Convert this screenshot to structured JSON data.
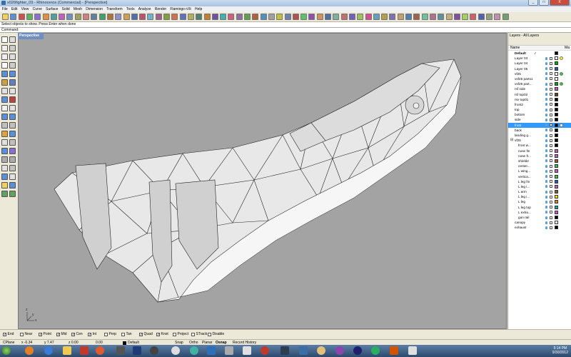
{
  "window": {
    "title": "x026fighter_09 - Rhinoceros (Commercial) - [Perspective]",
    "minimize": "_",
    "maximize": "□",
    "close": "X"
  },
  "menu": [
    "File",
    "Edit",
    "View",
    "Curve",
    "Surface",
    "Solid",
    "Mesh",
    "Dimension",
    "Transform",
    "Tools",
    "Analyze",
    "Render",
    "Flamingo nXt",
    "Help"
  ],
  "prompt": "Select objects to show. Press Enter when done",
  "command": {
    "label": "Command:"
  },
  "viewport": {
    "label": "Perspective",
    "axis_x": "x",
    "axis_y": "y",
    "axis_z": "z"
  },
  "layers_panel": {
    "title": "Layers - All Layers",
    "col_name": "Name",
    "col_mat": "Ma",
    "layers": [
      {
        "name": "Default",
        "bold": true,
        "check": "✓",
        "color": "#000000",
        "mat": false,
        "sel": false
      },
      {
        "name": "Layer 03",
        "color": "#ffffff",
        "mat": true,
        "mat_color": "#ffff00",
        "sel": false
      },
      {
        "name": "Layer 04",
        "color": "#00aa00",
        "mat": false,
        "sel": false
      },
      {
        "name": "Layer 05",
        "color": "#1f5fbf",
        "mat": false,
        "sel": false
      },
      {
        "name": "vf25",
        "color": "#ffffff",
        "mat": true,
        "mat_color": "#2ecc40",
        "sel": false
      },
      {
        "name": "vsf25 parts1",
        "color": "#ffffff",
        "mat": false,
        "sel": false
      },
      {
        "name": "vsf25 part...",
        "color": "#00aa00",
        "mat": true,
        "mat_color": "#2ecc40",
        "sel": false
      },
      {
        "name": "rsf side",
        "color": "#c65bcf",
        "mat": false,
        "sel": false
      },
      {
        "name": "rsf top02",
        "color": "#7f3f00",
        "mat": false,
        "sel": false
      },
      {
        "name": "rsv top01",
        "color": "#000000",
        "mat": false,
        "sel": false
      },
      {
        "name": "front2",
        "color": "#000000",
        "mat": false,
        "sel": false
      },
      {
        "name": "top",
        "color": "#000000",
        "mat": false,
        "sel": false
      },
      {
        "name": "bottom",
        "color": "#000000",
        "mat": false,
        "sel": false
      },
      {
        "name": "side",
        "color": "#000000",
        "mat": false,
        "sel": false
      },
      {
        "name": "front",
        "color": "#000000",
        "mat": true,
        "mat_color": "#ffffff",
        "sel": true
      },
      {
        "name": "back",
        "color": "#000000",
        "mat": false,
        "sel": false
      },
      {
        "name": "landing g...",
        "color": "#000000",
        "mat": false,
        "sel": false
      },
      {
        "name": "vf25",
        "color": "#000000",
        "mat": false,
        "sel": false,
        "group": true
      },
      {
        "name": "front w...",
        "color": "#000000",
        "mat": false,
        "sel": false,
        "indent": true
      },
      {
        "name": "nose fin",
        "color": "#c65bcf",
        "mat": false,
        "sel": false,
        "indent": true
      },
      {
        "name": "nose fr...",
        "color": "#c65bcf",
        "mat": false,
        "sel": false,
        "indent": true
      },
      {
        "name": "shield2",
        "color": "#a05a2c",
        "mat": false,
        "sel": false,
        "indent": true
      },
      {
        "name": "center...",
        "color": "#2ecc40",
        "mat": false,
        "sel": false,
        "indent": true
      },
      {
        "name": "L wing...",
        "color": "#c65bcf",
        "mat": false,
        "sel": false,
        "indent": true
      },
      {
        "name": "vertica...",
        "color": "#2ecc40",
        "mat": false,
        "sel": false,
        "indent": true
      },
      {
        "name": "L leg fin",
        "color": "#1f5fbf",
        "mat": false,
        "sel": false,
        "indent": true
      },
      {
        "name": "L leg i...",
        "color": "#c65bcf",
        "mat": false,
        "sel": false,
        "indent": true
      },
      {
        "name": "L arm",
        "color": "#8b5a2b",
        "mat": false,
        "sel": false,
        "indent": true
      },
      {
        "name": "L leg i...",
        "color": "#e6e600",
        "mat": false,
        "sel": false,
        "indent": true
      },
      {
        "name": "L leg",
        "color": "#e67e22",
        "mat": false,
        "sel": false,
        "indent": true
      },
      {
        "name": "L leg top",
        "color": "#00aaaa",
        "mat": false,
        "sel": false,
        "indent": true
      },
      {
        "name": "L exha...",
        "color": "#c65bcf",
        "mat": false,
        "sel": false,
        "indent": true
      },
      {
        "name": "gun rail",
        "color": "#000000",
        "mat": false,
        "sel": false,
        "indent": true
      },
      {
        "name": "canopy",
        "color": "#ffffff",
        "mat": false,
        "sel": false
      },
      {
        "name": "exhaust",
        "color": "#000000",
        "mat": false,
        "sel": false
      }
    ]
  },
  "osnaps": [
    {
      "label": "End",
      "checked": true
    },
    {
      "label": "Near",
      "checked": false
    },
    {
      "label": "Point",
      "checked": true
    },
    {
      "label": "Mid",
      "checked": true
    },
    {
      "label": "Cen",
      "checked": true
    },
    {
      "label": "Int",
      "checked": true
    },
    {
      "label": "Perp",
      "checked": false
    },
    {
      "label": "Tan",
      "checked": false
    },
    {
      "label": "Quad",
      "checked": true
    },
    {
      "label": "Knot",
      "checked": true
    },
    {
      "label": "Project",
      "checked": false
    },
    {
      "label": "STrack",
      "checked": false
    },
    {
      "label": "Disable",
      "checked": false
    }
  ],
  "status": {
    "cplane": "CPlane",
    "x": "x -0.34",
    "y": "y 7.47",
    "z": "z 0.00",
    "extra": "0.00",
    "layer": "Default",
    "snap": "Snap",
    "ortho": "Ortho",
    "planar": "Planar",
    "osnap": "Osnap",
    "history": "Record History"
  },
  "clock": {
    "time": "5:14 PM",
    "date": "9/30/2012"
  },
  "colors": {
    "viewport_bg": "#a3a3a3",
    "model_face": "#e8e8e8",
    "taskbar": "#2d4a6d",
    "selection": "#3399ff"
  },
  "icons": [
    "rhino-app-icon",
    "select-arrow-icon",
    "point-icon",
    "curve-icon",
    "circle-icon",
    "polyline-icon",
    "surface-icon",
    "solid-icon",
    "mesh-icon",
    "transform-icon",
    "dimension-icon",
    "render-icon"
  ]
}
